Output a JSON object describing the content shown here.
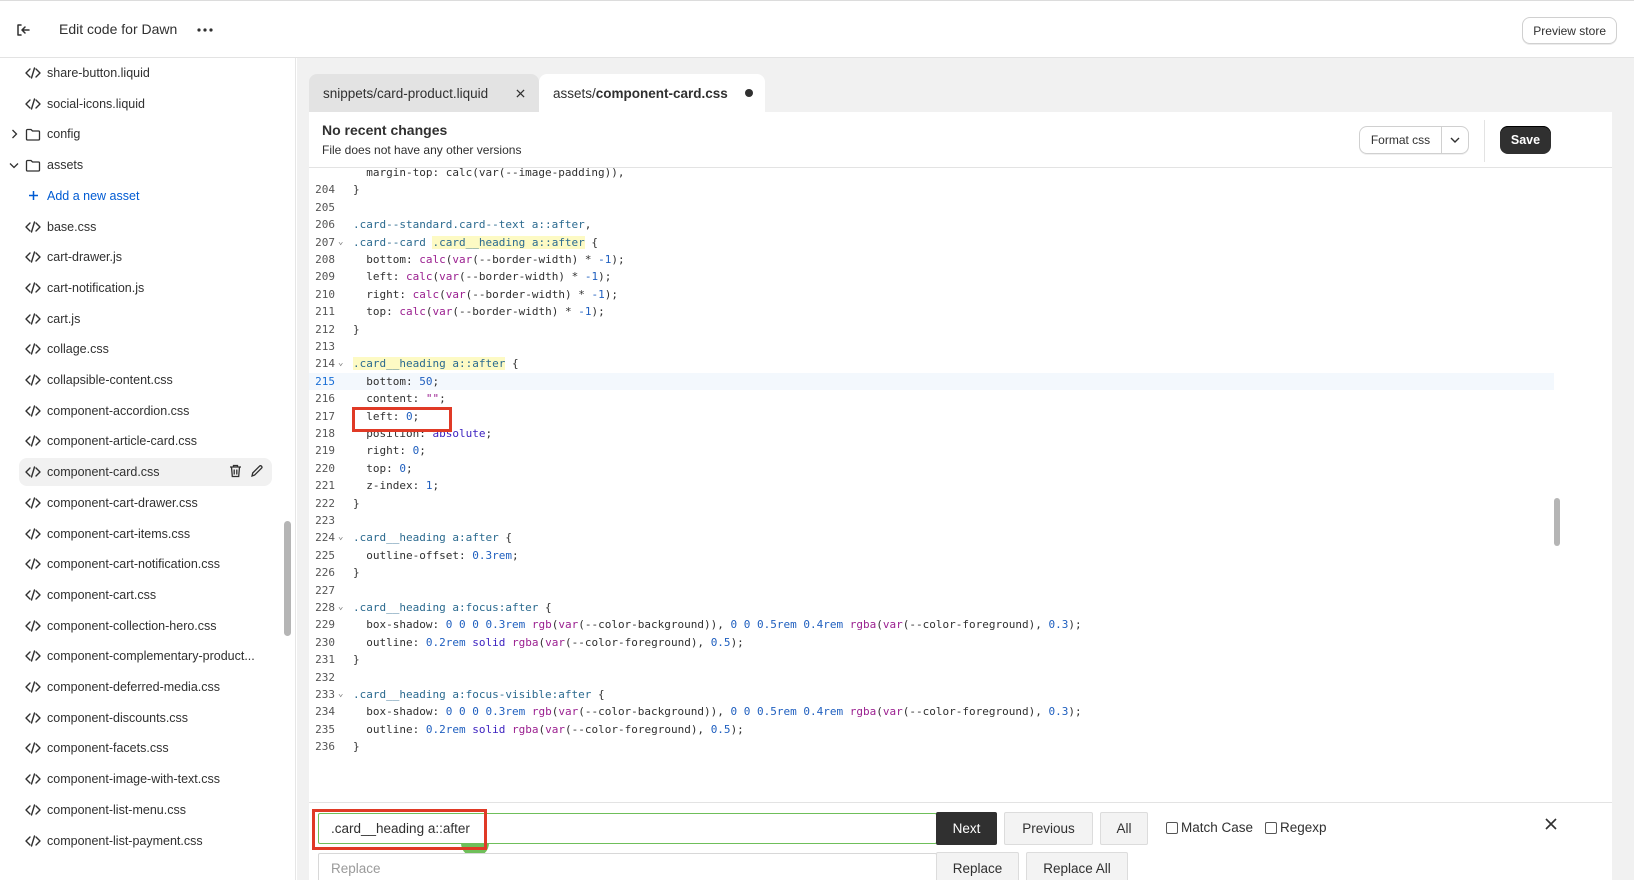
{
  "header": {
    "title": "Edit code for Dawn",
    "preview_label": "Preview store"
  },
  "sidebar": {
    "items": [
      {
        "label": "share-button.liquid",
        "type": "file"
      },
      {
        "label": "social-icons.liquid",
        "type": "file"
      },
      {
        "label": "config",
        "type": "folder-collapsed"
      },
      {
        "label": "assets",
        "type": "folder-expanded"
      },
      {
        "label": "Add a new asset",
        "type": "add"
      },
      {
        "label": "base.css",
        "type": "file"
      },
      {
        "label": "cart-drawer.js",
        "type": "file"
      },
      {
        "label": "cart-notification.js",
        "type": "file"
      },
      {
        "label": "cart.js",
        "type": "file"
      },
      {
        "label": "collage.css",
        "type": "file"
      },
      {
        "label": "collapsible-content.css",
        "type": "file"
      },
      {
        "label": "component-accordion.css",
        "type": "file"
      },
      {
        "label": "component-article-card.css",
        "type": "file"
      },
      {
        "label": "component-card.css",
        "type": "file-active"
      },
      {
        "label": "component-cart-drawer.css",
        "type": "file"
      },
      {
        "label": "component-cart-items.css",
        "type": "file"
      },
      {
        "label": "component-cart-notification.css",
        "type": "file"
      },
      {
        "label": "component-cart.css",
        "type": "file"
      },
      {
        "label": "component-collection-hero.css",
        "type": "file"
      },
      {
        "label": "component-complementary-product...",
        "type": "file"
      },
      {
        "label": "component-deferred-media.css",
        "type": "file"
      },
      {
        "label": "component-discounts.css",
        "type": "file"
      },
      {
        "label": "component-facets.css",
        "type": "file"
      },
      {
        "label": "component-image-with-text.css",
        "type": "file"
      },
      {
        "label": "component-list-menu.css",
        "type": "file"
      },
      {
        "label": "component-list-payment.css",
        "type": "file"
      }
    ]
  },
  "tabs": [
    {
      "label": "snippets/card-product.liquid"
    },
    {
      "prefix": "assets/",
      "name": "component-card.css"
    }
  ],
  "infobar": {
    "title": "No recent changes",
    "subtitle": "File does not have any other versions",
    "format_label": "Format css",
    "save_label": "Save"
  },
  "code": {
    "current_line": 215,
    "lines": [
      {
        "n": "",
        "html": "  margin-top: calc(var(--image-padding)),"
      },
      {
        "n": "204",
        "html": "}"
      },
      {
        "n": "205",
        "html": ""
      },
      {
        "n": "206",
        "html": "<span class='t-sel'>.card--standard.card--text a::after</span>,"
      },
      {
        "n": "207",
        "fold": true,
        "html": "<span class='t-sel'>.card--card</span> <span class='t-sel t-hl'>.card__heading a::after</span> {"
      },
      {
        "n": "208",
        "html": "  bottom: <span class='t-fn'>calc</span>(<span class='t-fn'>var</span>(--border-width) * <span class='t-num'>-1</span>);"
      },
      {
        "n": "209",
        "html": "  left: <span class='t-fn'>calc</span>(<span class='t-fn'>var</span>(--border-width) * <span class='t-num'>-1</span>);"
      },
      {
        "n": "210",
        "html": "  right: <span class='t-fn'>calc</span>(<span class='t-fn'>var</span>(--border-width) * <span class='t-num'>-1</span>);"
      },
      {
        "n": "211",
        "html": "  top: <span class='t-fn'>calc</span>(<span class='t-fn'>var</span>(--border-width) * <span class='t-num'>-1</span>);"
      },
      {
        "n": "212",
        "html": "}"
      },
      {
        "n": "213",
        "html": ""
      },
      {
        "n": "214",
        "fold": true,
        "html": "<span class='t-sel t-hl'>.card__heading a::after</span> {"
      },
      {
        "n": "215",
        "html": "  bottom: <span class='t-num'>50</span>;"
      },
      {
        "n": "216",
        "html": "  content: <span class='t-fn'>\"\"</span>;"
      },
      {
        "n": "217",
        "html": "  left: <span class='t-num'>0</span>;"
      },
      {
        "n": "218",
        "html": "  position: <span class='t-kw'>absolute</span>;"
      },
      {
        "n": "219",
        "html": "  right: <span class='t-num'>0</span>;"
      },
      {
        "n": "220",
        "html": "  top: <span class='t-num'>0</span>;"
      },
      {
        "n": "221",
        "html": "  z-index: <span class='t-num'>1</span>;"
      },
      {
        "n": "222",
        "html": "}"
      },
      {
        "n": "223",
        "html": ""
      },
      {
        "n": "224",
        "fold": true,
        "html": "<span class='t-sel'>.card__heading a:after</span> {"
      },
      {
        "n": "225",
        "html": "  outline-offset: <span class='t-num'>0.3rem</span>;"
      },
      {
        "n": "226",
        "html": "}"
      },
      {
        "n": "227",
        "html": ""
      },
      {
        "n": "228",
        "fold": true,
        "html": "<span class='t-sel'>.card__heading a:focus:after</span> {"
      },
      {
        "n": "229",
        "html": "  box-shadow: <span class='t-num'>0 0 0 0.3rem</span> <span class='t-fn'>rgb</span>(<span class='t-fn'>var</span>(--color-background)), <span class='t-num'>0 0 0.5rem 0.4rem</span> <span class='t-fn'>rgba</span>(<span class='t-fn'>var</span>(--color-foreground), <span class='t-num'>0.3</span>);"
      },
      {
        "n": "230",
        "html": "  outline: <span class='t-num'>0.2rem</span> <span class='t-kw'>solid</span> <span class='t-fn'>rgba</span>(<span class='t-fn'>var</span>(--color-foreground), <span class='t-num'>0.5</span>);"
      },
      {
        "n": "231",
        "html": "}"
      },
      {
        "n": "232",
        "html": ""
      },
      {
        "n": "233",
        "fold": true,
        "html": "<span class='t-sel'>.card__heading a:focus-visible:after</span> {"
      },
      {
        "n": "234",
        "html": "  box-shadow: <span class='t-num'>0 0 0 0.3rem</span> <span class='t-fn'>rgb</span>(<span class='t-fn'>var</span>(--color-background)), <span class='t-num'>0 0 0.5rem 0.4rem</span> <span class='t-fn'>rgba</span>(<span class='t-fn'>var</span>(--color-foreground), <span class='t-num'>0.3</span>);"
      },
      {
        "n": "235",
        "html": "  outline: <span class='t-num'>0.2rem</span> <span class='t-kw'>solid</span> <span class='t-fn'>rgba</span>(<span class='t-fn'>var</span>(--color-foreground), <span class='t-num'>0.5</span>);"
      },
      {
        "n": "236",
        "html": "}"
      }
    ]
  },
  "search": {
    "find_value": ".card__heading a::after",
    "replace_placeholder": "Replace",
    "next_label": "Next",
    "previous_label": "Previous",
    "all_label": "All",
    "match_case_label": "Match Case",
    "regexp_label": "Regexp",
    "replace_label": "Replace",
    "replace_all_label": "Replace All"
  },
  "colors": {
    "accent": "#005bd3",
    "annotation": "#e03a26",
    "find_border": "#6fbf5a",
    "primary_button": "#303030"
  }
}
